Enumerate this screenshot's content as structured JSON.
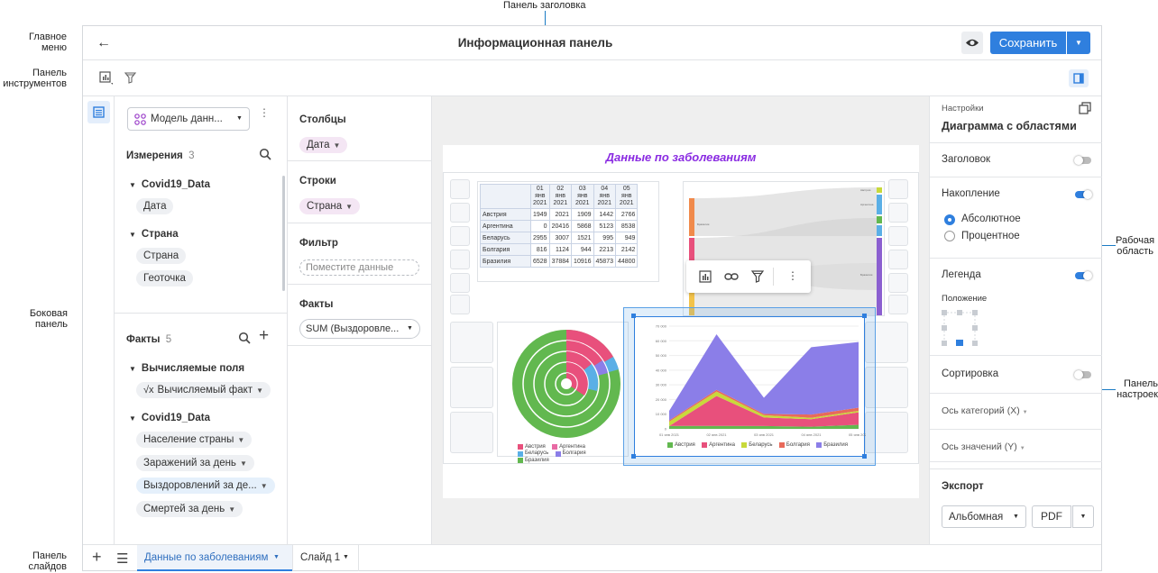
{
  "callouts": {
    "title_panel": "Панель заголовка",
    "main_menu_1": "Главное",
    "main_menu_2": "меню",
    "toolbar_1": "Панель",
    "toolbar_2": "инструментов",
    "sidebar_1": "Боковая",
    "sidebar_2": "панель",
    "slides_1": "Панель",
    "slides_2": "слайдов",
    "workspace_1": "Рабочая",
    "workspace_2": "область",
    "settings_1": "Панель",
    "settings_2": "настроек"
  },
  "header": {
    "title": "Информационная панель",
    "save_label": "Сохранить"
  },
  "sidebar": {
    "model_select": "Модель данн...",
    "dimensions_label": "Измерения",
    "dimensions_count": "3",
    "dim_group1": "Covid19_Data",
    "dim_item_date": "Дата",
    "dim_group2": "Страна",
    "dim_item_country": "Страна",
    "dim_item_geo": "Геоточка",
    "facts_label": "Факты",
    "facts_count": "5",
    "fact_group1": "Вычисляемые поля",
    "fact_calc": "Вычисляемый факт",
    "fact_group2": "Covid19_Data",
    "fact_items": [
      "Население страны",
      "Заражений за день",
      "Выздоровлений за де...",
      "Смертей за день"
    ]
  },
  "fields": {
    "columns_label": "Столбцы",
    "columns_chip": "Дата",
    "rows_label": "Строки",
    "rows_chip": "Страна",
    "filter_label": "Фильтр",
    "filter_placeholder": "Поместите данные",
    "facts_label": "Факты",
    "facts_select": "SUM (Выздоровле..."
  },
  "workspace": {
    "title": "Данные по заболеваниям",
    "table": {
      "col_headers": [
        [
          "01",
          "янв",
          "2021"
        ],
        [
          "02",
          "янв",
          "2021"
        ],
        [
          "03",
          "янв",
          "2021"
        ],
        [
          "04",
          "янв",
          "2021"
        ],
        [
          "05",
          "янв",
          "2021"
        ]
      ],
      "rows": [
        {
          "name": "Австрия",
          "values": [
            "1949",
            "2021",
            "1909",
            "1442",
            "2766"
          ]
        },
        {
          "name": "Аргентина",
          "values": [
            "0",
            "20416",
            "5868",
            "5123",
            "8538"
          ]
        },
        {
          "name": "Беларусь",
          "values": [
            "2955",
            "3007",
            "1521",
            "995",
            "949"
          ]
        },
        {
          "name": "Болгария",
          "values": [
            "816",
            "1124",
            "944",
            "2213",
            "2142"
          ]
        },
        {
          "name": "Бразилия",
          "values": [
            "6528",
            "37884",
            "10916",
            "45873",
            "44800"
          ]
        }
      ]
    },
    "donut_legend": [
      "Австрия",
      "Аргентина",
      "Беларусь",
      "Болгария",
      "Бразилия"
    ],
    "area_legend": [
      "Австрия",
      "Аргентина",
      "Беларусь",
      "Болгария",
      "Бразилия"
    ],
    "sankey_labels": [
      "Бразилия",
      "Аргентина",
      "Австрия"
    ]
  },
  "chart_data": {
    "type": "area",
    "x": [
      "01 янв 2021",
      "02 янв 2021",
      "03 янв 2021",
      "04 янв 2021",
      "05 янв 2021"
    ],
    "ylim": [
      0,
      70000
    ],
    "yticks": [
      "70 000",
      "60 000",
      "50 000",
      "40 000",
      "30 000",
      "20 000",
      "10 000",
      "0"
    ],
    "stacked": true,
    "series": [
      {
        "name": "Австрия",
        "color": "#62b84f",
        "values": [
          1949,
          2021,
          1909,
          1442,
          2766
        ]
      },
      {
        "name": "Аргентина",
        "color": "#e8507c",
        "values": [
          0,
          20416,
          5868,
          5123,
          8538
        ]
      },
      {
        "name": "Беларусь",
        "color": "#c8d93a",
        "values": [
          2955,
          3007,
          1521,
          995,
          949
        ]
      },
      {
        "name": "Болгария",
        "color": "#e86a5a",
        "values": [
          816,
          1124,
          944,
          2213,
          2142
        ]
      },
      {
        "name": "Бразилия",
        "color": "#8b7ee8",
        "values": [
          6528,
          37884,
          10916,
          45873,
          44800
        ]
      }
    ],
    "legend_position": "bottom"
  },
  "settings": {
    "caption": "Настройки",
    "chart_type": "Диаграмма с областями",
    "header_label": "Заголовок",
    "accumulation_label": "Накопление",
    "absolute_label": "Абсолютное",
    "percent_label": "Процентное",
    "legend_label": "Легенда",
    "position_label": "Положение",
    "sorting_label": "Сортировка",
    "x_axis_label": "Ось категорий (X)",
    "y_axis_label": "Ось значений (Y)",
    "export_label": "Экспорт",
    "orientation_select": "Альбомная",
    "format_label": "PDF"
  },
  "slides": {
    "tab_active": "Данные по заболеваниям",
    "tab2": "Слайд 1"
  },
  "colors": {
    "accent": "#2f7fde",
    "title_purple": "#8a2be2",
    "callout_blue": "#1a7bc4"
  }
}
